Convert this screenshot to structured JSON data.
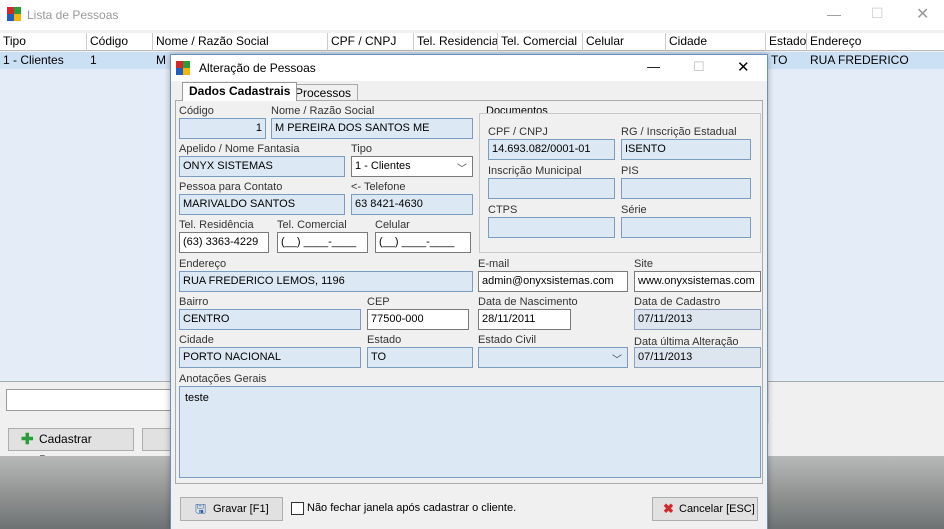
{
  "bg_window": {
    "title": "Lista de Pessoas",
    "columns": [
      "Tipo",
      "Código",
      "Nome / Razão Social",
      "CPF / CNPJ",
      "Tel. Residencial",
      "Tel. Comercial",
      "Celular",
      "Cidade",
      "Estado",
      "Endereço"
    ],
    "row": {
      "tipo": "1 - Clientes",
      "codigo": "1",
      "nome": "M P",
      "estado": "TO",
      "endereco": "RUA FREDERICO"
    },
    "add_button": "Cadastrar Pessoa"
  },
  "dialog": {
    "title": "Alteração de Pessoas",
    "tabs": [
      "Dados Cadastrais",
      "Processos"
    ],
    "labels": {
      "codigo": "Código",
      "nome": "Nome / Razão Social",
      "apelido": "Apelido / Nome Fantasia",
      "tipo": "Tipo",
      "contato": "Pessoa para Contato",
      "telefone": "<- Telefone",
      "tel_res": "Tel. Residência",
      "tel_com": "Tel. Comercial",
      "celular": "Celular",
      "documentos": "Documentos",
      "cpf": "CPF / CNPJ",
      "rg": "RG / Inscrição Estadual",
      "insc_mun": "Inscrição Municipal",
      "pis": "PIS",
      "ctps": "CTPS",
      "serie": "Série",
      "endereco": "Endereço",
      "email": "E-mail",
      "site": "Site",
      "bairro": "Bairro",
      "cep": "CEP",
      "nascimento": "Data de Nascimento",
      "cadastro": "Data de Cadastro",
      "cidade": "Cidade",
      "estado": "Estado",
      "estado_civil": "Estado Civil",
      "alteracao": "Data última Alteração",
      "anotacoes": "Anotações Gerais"
    },
    "values": {
      "codigo": "1",
      "nome": "M PEREIRA DOS SANTOS ME",
      "apelido": "ONYX SISTEMAS",
      "tipo": "1 - Clientes",
      "contato": "MARIVALDO SANTOS",
      "telefone": "63 8421-4630",
      "tel_res": "(63) 3363-4229",
      "tel_com": "(__) ____-____",
      "celular": "(__) ____-____",
      "cpf": "14.693.082/0001-01",
      "rg": "ISENTO",
      "insc_mun": "",
      "pis": "",
      "ctps": "",
      "serie": "",
      "endereco": "RUA FREDERICO LEMOS, 1196",
      "email": "admin@onyxsistemas.com",
      "site": "www.onyxsistemas.com",
      "bairro": "CENTRO",
      "cep": "77500-000",
      "nascimento": "28/11/2011",
      "cadastro": "07/11/2013",
      "cidade": "PORTO NACIONAL",
      "estado": "TO",
      "estado_civil": "",
      "alteracao": "07/11/2013",
      "anotacoes": "teste"
    },
    "footer": {
      "save": "Gravar [F1]",
      "keep_open": "Não fechar janela após cadastrar o cliente.",
      "cancel": "Cancelar [ESC]"
    }
  },
  "colors": {
    "accent": "#0078d7",
    "field_blue": "#dce8f3",
    "selected_row": "#cce0f5"
  }
}
